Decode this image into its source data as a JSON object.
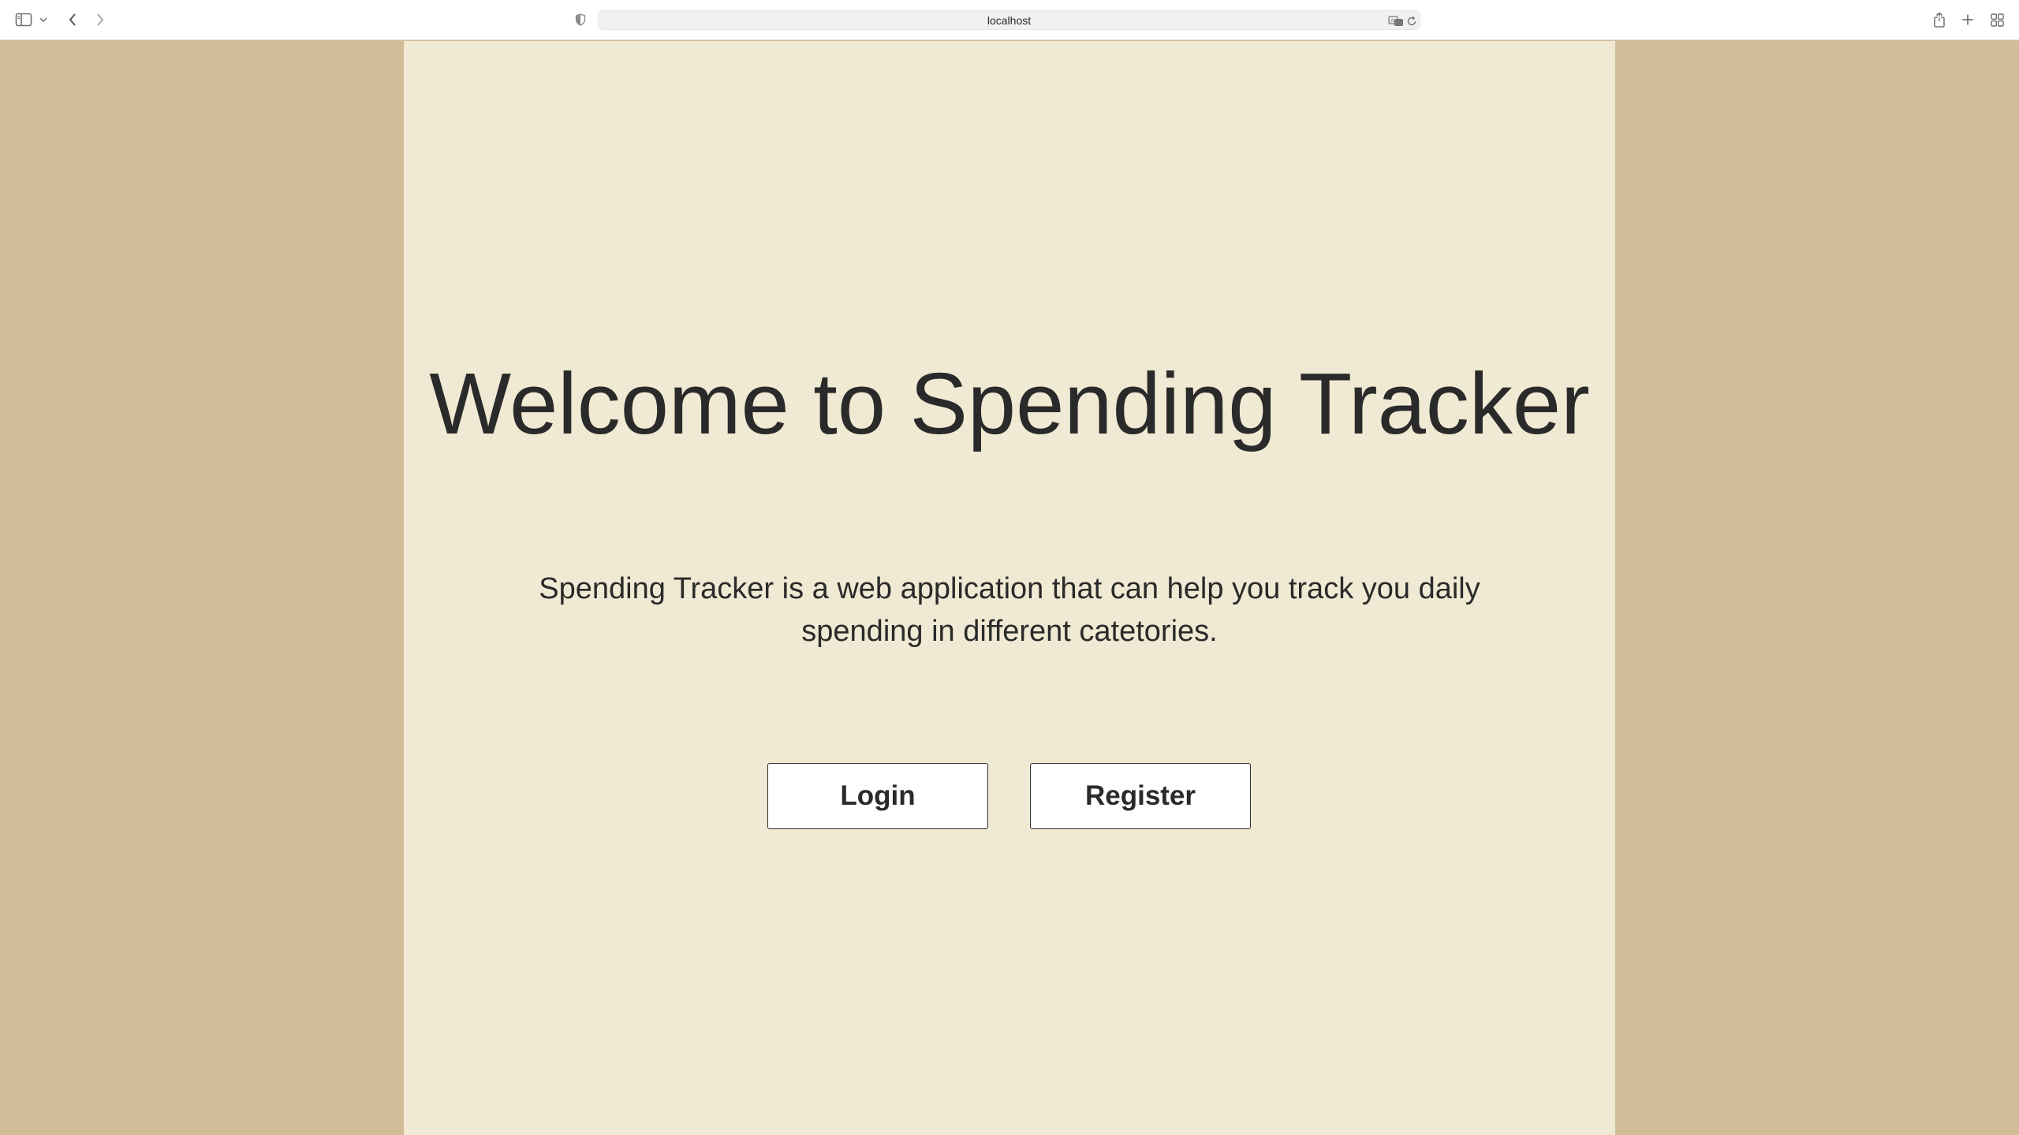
{
  "browser": {
    "address": "localhost",
    "icons": {
      "sidebar": "sidebar-icon",
      "sidebar_menu": "chevron-down-icon",
      "back": "chevron-left-icon",
      "forward": "chevron-right-icon",
      "privacy": "shield-icon",
      "translate": "translate-icon",
      "reload": "reload-icon",
      "share": "share-icon",
      "new_tab": "plus-icon",
      "tab_overview": "grid-icon"
    }
  },
  "page": {
    "title": "Welcome to Spending Tracker",
    "description": "Spending Tracker is a web application that can help you track you daily spending in different catetories.",
    "login_label": "Login",
    "register_label": "Register"
  },
  "colors": {
    "outer_background": "#d3bc98",
    "content_background": "#f0e9d3",
    "text": "#2a2a2a",
    "button_background": "#ffffff",
    "button_border": "#2f2f2f"
  }
}
